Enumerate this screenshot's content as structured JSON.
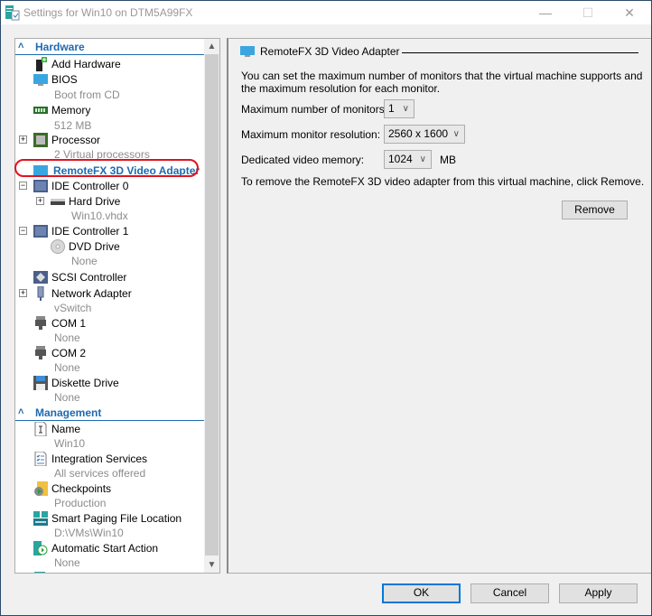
{
  "window": {
    "title": "Settings for Win10 on DTM5A99FX",
    "controls": {
      "minimize": "—",
      "maximize": "☐",
      "close": "✕"
    }
  },
  "tree": {
    "sections": [
      {
        "label": "Hardware",
        "icon": "chevron-double-up-icon"
      },
      {
        "label": "Management",
        "icon": "chevron-double-up-icon"
      }
    ],
    "hardware_items": [
      {
        "label": "Add Hardware",
        "sub": null,
        "icon": "add-hardware-icon"
      },
      {
        "label": "BIOS",
        "sub": "Boot from CD",
        "icon": "monitor-icon"
      },
      {
        "label": "Memory",
        "sub": "512 MB",
        "icon": "memory-icon"
      },
      {
        "label": "Processor",
        "sub": "2 Virtual processors",
        "icon": "processor-icon",
        "expander": "+"
      },
      {
        "label": "RemoteFX 3D Video Adapter",
        "sub": null,
        "icon": "monitor-icon",
        "selected": true
      },
      {
        "label": "IDE Controller 0",
        "sub": null,
        "icon": "ide-controller-icon",
        "expander": "−"
      },
      {
        "label": "Hard Drive",
        "sub": "Win10.vhdx",
        "icon": "hard-drive-icon",
        "expander": "+"
      },
      {
        "label": "IDE Controller 1",
        "sub": null,
        "icon": "ide-controller-icon",
        "expander": "−"
      },
      {
        "label": "DVD Drive",
        "sub": "None",
        "icon": "dvd-drive-icon"
      },
      {
        "label": "SCSI Controller",
        "sub": null,
        "icon": "scsi-controller-icon"
      },
      {
        "label": "Network Adapter",
        "sub": "vSwitch",
        "icon": "network-adapter-icon",
        "expander": "+"
      },
      {
        "label": "COM 1",
        "sub": "None",
        "icon": "com-port-icon"
      },
      {
        "label": "COM 2",
        "sub": "None",
        "icon": "com-port-icon"
      },
      {
        "label": "Diskette Drive",
        "sub": "None",
        "icon": "floppy-icon"
      }
    ],
    "management_items": [
      {
        "label": "Name",
        "sub": "Win10",
        "icon": "name-icon"
      },
      {
        "label": "Integration Services",
        "sub": "All services offered",
        "icon": "integration-services-icon"
      },
      {
        "label": "Checkpoints",
        "sub": "Production",
        "icon": "checkpoints-icon"
      },
      {
        "label": "Smart Paging File Location",
        "sub": "D:\\VMs\\Win10",
        "icon": "smart-paging-icon"
      },
      {
        "label": "Automatic Start Action",
        "sub": "None",
        "icon": "automatic-start-icon"
      }
    ],
    "scroll": {
      "up": "⌃",
      "down": "⌄"
    }
  },
  "content": {
    "title": "RemoteFX 3D Video Adapter",
    "description": "You can set the maximum number of monitors that the virtual machine supports and the maximum resolution for each monitor.",
    "fields": [
      {
        "label": "Maximum number of monitors:",
        "value": "1"
      },
      {
        "label": "Maximum monitor resolution:",
        "value": "2560 x 1600"
      },
      {
        "label": "Dedicated video memory:",
        "value": "1024",
        "unit": "MB"
      }
    ],
    "remove_note": "To remove the RemoteFX 3D video adapter from this virtual machine, click Remove.",
    "remove_button": "Remove"
  },
  "footer": {
    "ok": "OK",
    "cancel": "Cancel",
    "apply": "Apply"
  },
  "colors": {
    "accent": "#1e6ab0",
    "highlight": "#e0141e",
    "focus": "#0078d7"
  }
}
